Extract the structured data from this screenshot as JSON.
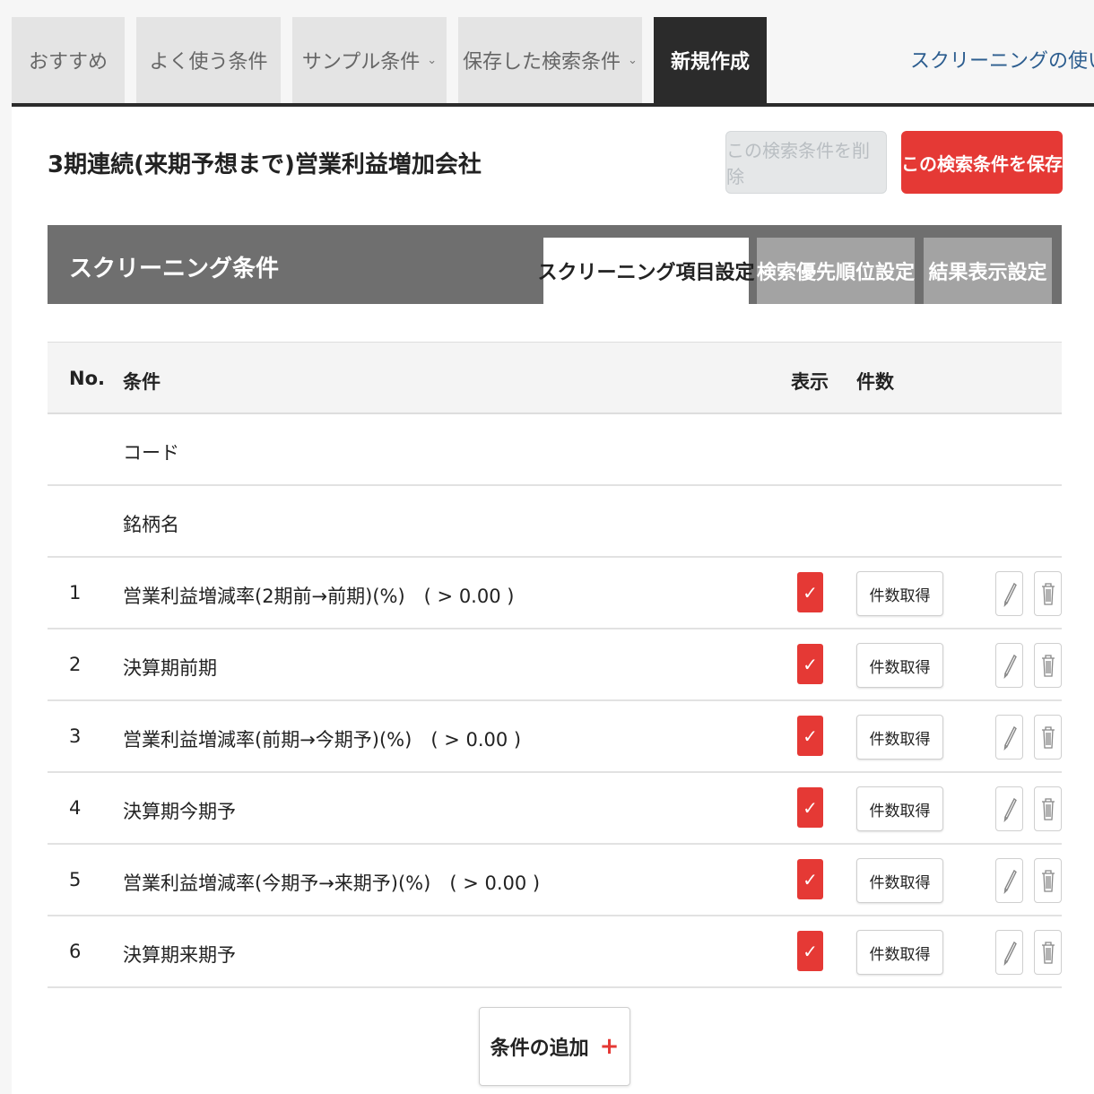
{
  "tabs": [
    {
      "label": "おすすめ"
    },
    {
      "label": "よく使う条件"
    },
    {
      "label": "サンプル条件"
    },
    {
      "label": "保存した検索条件"
    },
    {
      "label": "新規作成"
    }
  ],
  "caret": "⌄",
  "help_link": "スクリーニングの使い方",
  "page_title": "3期連続(来期予想まで)営業利益増加会社",
  "buttons": {
    "delete": "この検索条件を削除",
    "save": "この検索条件を保存",
    "add": "条件の追加",
    "add_icon": "+"
  },
  "conditions_header": {
    "label": "スクリーニング条件",
    "subtabs": [
      "スクリーニング項目設定",
      "検索優先順位設定",
      "結果表示設定"
    ]
  },
  "table": {
    "headers": {
      "no": "No.",
      "condition": "条件",
      "display": "表示",
      "count": "件数"
    },
    "fixed_rows": [
      "コード",
      "銘柄名"
    ],
    "rows": [
      {
        "no": "1",
        "condition": "営業利益増減率(2期前→前期)(%)　( > 0.00 )",
        "count_label": "件数取得"
      },
      {
        "no": "2",
        "condition": "決算期前期",
        "count_label": "件数取得"
      },
      {
        "no": "3",
        "condition": "営業利益増減率(前期→今期予)(%)　( > 0.00 )",
        "count_label": "件数取得"
      },
      {
        "no": "4",
        "condition": "決算期今期予",
        "count_label": "件数取得"
      },
      {
        "no": "5",
        "condition": "営業利益増減率(今期予→来期予)(%)　( > 0.00 )",
        "count_label": "件数取得"
      },
      {
        "no": "6",
        "condition": "決算期来期予",
        "count_label": "件数取得"
      }
    ]
  },
  "colors": {
    "accent_red": "#e53935",
    "dark_tab": "#2b2b2b",
    "header_gray": "#6f6f6f"
  },
  "icons": {
    "check": "checkmark-icon",
    "edit": "pencil-icon",
    "delete": "trash-icon",
    "external": "external-link-icon"
  }
}
